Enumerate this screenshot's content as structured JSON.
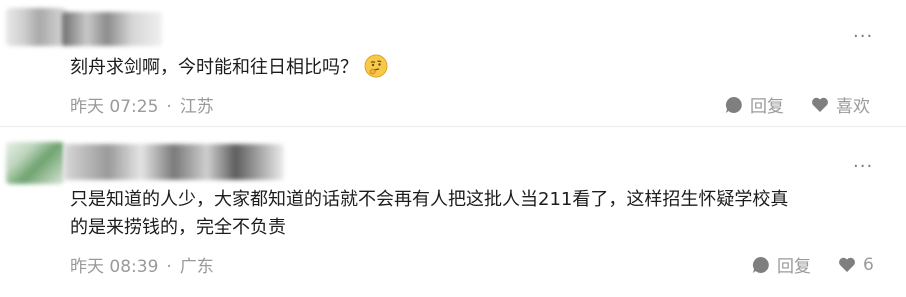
{
  "comments": [
    {
      "text": "刻舟求剑啊，今时能和往日相比吗？",
      "emoji": "thinking-face-emoji",
      "time": "昨天 07:25",
      "location": "江苏",
      "reply_label": "回复",
      "like_label": "喜欢"
    },
    {
      "text_line1": "只是知道的人少，大家都知道的话就不会再有人把这批人当211看了，这样招生怀疑学校真",
      "text_line2": "的是来捞钱的，完全不负责",
      "time": "昨天 08:39",
      "location": "广东",
      "reply_label": "回复",
      "like_count": "6"
    }
  ],
  "separator": "·",
  "more_icon": "···",
  "colors": {
    "meta": "#9a9a9a",
    "icon": "#8a8a8a",
    "text": "#1c1c1c"
  }
}
